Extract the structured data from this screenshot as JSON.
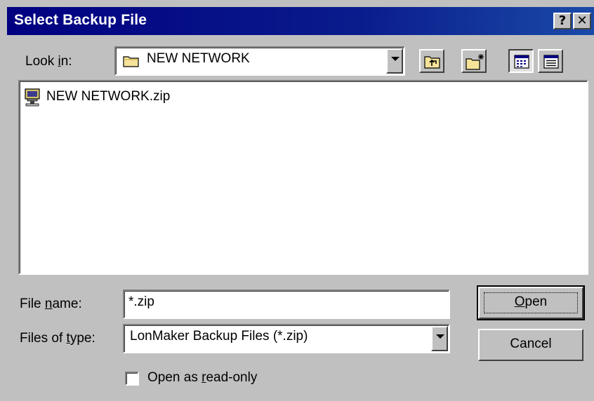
{
  "window": {
    "title": "Select Backup File",
    "help_button": "?",
    "close_button": "✕",
    "title_color": "#000080"
  },
  "look_in": {
    "label_pre": "Look ",
    "label_hotkey": "i",
    "label_post": "n:",
    "value": "NEW NETWORK",
    "icon": "folder-icon"
  },
  "toolbar": {
    "up_one_level": "up-folder-icon",
    "create_new_folder": "new-folder-icon",
    "list_view": "list-view-icon",
    "details_view": "details-view-icon"
  },
  "files": [
    {
      "name": "NEW NETWORK.zip",
      "icon": "network-file-icon"
    }
  ],
  "file_name": {
    "label_pre": "File ",
    "label_hotkey": "n",
    "label_post": "ame:",
    "value": "*.zip"
  },
  "files_of_type": {
    "label_pre": "Files of ",
    "label_hotkey": "t",
    "label_post": "ype:",
    "value": "LonMaker Backup Files  (*.zip)"
  },
  "buttons": {
    "open_hotkey": "O",
    "open_rest": "pen",
    "cancel": "Cancel"
  },
  "read_only": {
    "label_pre": "Open as ",
    "label_hotkey": "r",
    "label_post": "ead-only",
    "checked": false
  }
}
